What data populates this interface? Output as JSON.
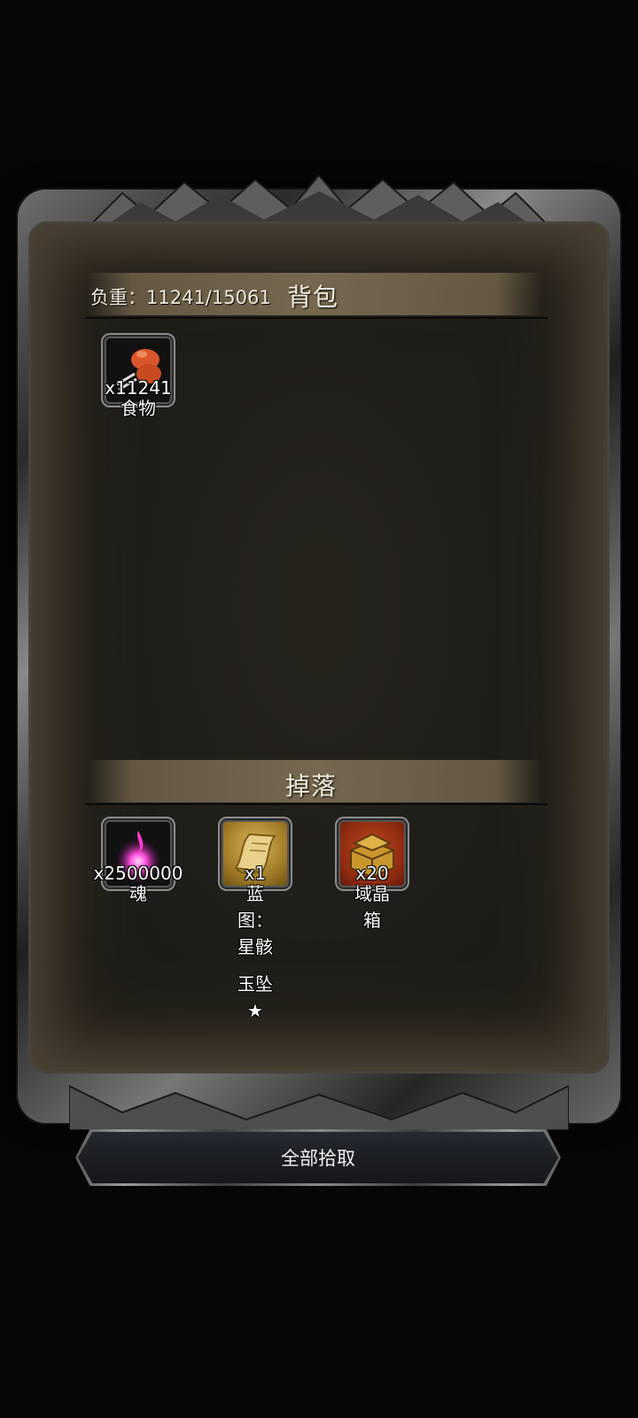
{
  "inventory": {
    "weight_text": "负重：11241/15061",
    "title": "背包",
    "items": [
      {
        "count": "x11241",
        "name": "食物",
        "icon": "food-meat-icon"
      }
    ]
  },
  "drops": {
    "title": "掉落",
    "items": [
      {
        "count": "x2500000",
        "name": "魂",
        "icon": "soul-orb-icon"
      },
      {
        "count": "x1",
        "name_line1": "蓝图：星骸",
        "name_line2": "玉坠★",
        "icon": "blueprint-scroll-icon"
      },
      {
        "count": "x20",
        "name": "域晶箱",
        "icon": "treasure-chest-icon"
      }
    ]
  },
  "actions": {
    "collect_all_label": "全部拾取"
  },
  "colors": {
    "panel_bg": "#1f1d19",
    "header_band": "#7a6c52",
    "slot_gold": "#a07a26",
    "slot_red": "#8c2a10"
  }
}
